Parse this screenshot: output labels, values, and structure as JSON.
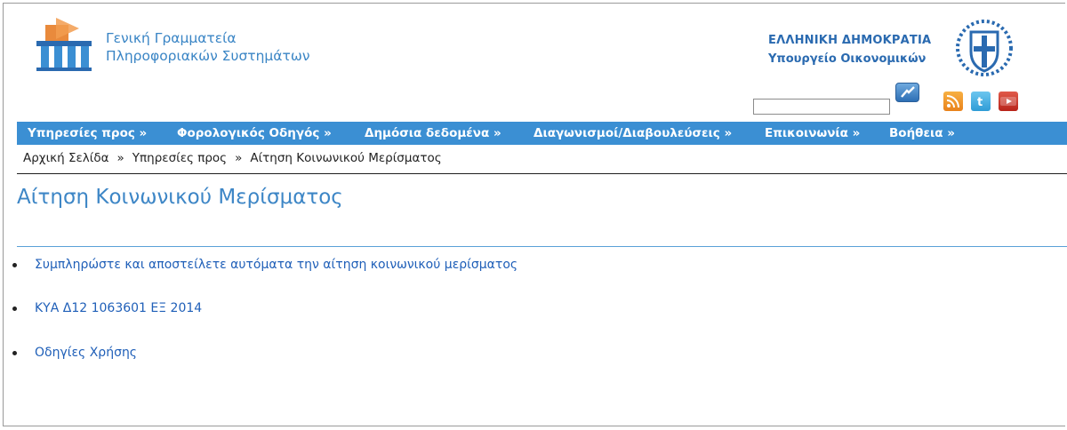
{
  "header": {
    "org_line1": "Γενική Γραμματεία",
    "org_line2": "Πληροφοριακών Συστημάτων",
    "gov_line1": "ΕΛΛΗΝΙΚΗ ΔΗΜΟΚΡΑΤΙΑ",
    "gov_line2": "Υπουργείο Οικονομικών",
    "logo_icon": "gsis-logo-icon",
    "emblem_icon": "greek-coat-of-arms-icon"
  },
  "search": {
    "value": "",
    "button_icon": "search-icon"
  },
  "social": [
    {
      "name": "rss-icon",
      "color": "#f0982c"
    },
    {
      "name": "twitter-icon",
      "color": "#3fb0e4"
    },
    {
      "name": "youtube-icon",
      "color": "#cc3a2c"
    }
  ],
  "nav": {
    "items": [
      "Υπηρεσίες προς »",
      "Φορολογικός Οδηγός »",
      "Δημόσια δεδομένα »",
      "Διαγωνισμοί/Διαβουλεύσεις »",
      "Επικοινωνία »",
      "Βοήθεια »"
    ],
    "bg_color": "#3b8fd3"
  },
  "breadcrumb": {
    "items": [
      "Αρχική Σελίδα",
      "Υπηρεσίες προς",
      "Αίτηση Κοινωνικού Μερίσματος"
    ],
    "separator": "»"
  },
  "page_title": "Αίτηση Κοινωνικού Μερίσματος",
  "links": [
    "Συμπληρώστε και αποστείλετε αυτόματα την αίτηση κοινωνικού μερίσματος",
    "ΚΥΑ Δ12 1063601 ΕΞ 2014",
    "Οδηγίες Χρήσης"
  ],
  "colors": {
    "link": "#1f5fb8",
    "title": "#3d86c6",
    "accent": "#3b8fd3"
  }
}
